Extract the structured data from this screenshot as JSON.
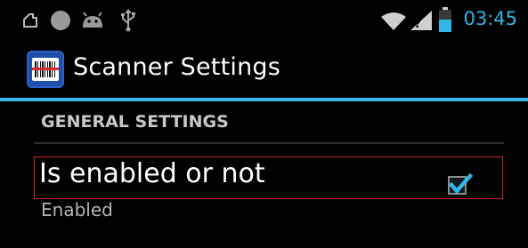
{
  "status_bar": {
    "time": "03:45",
    "time_color": "#33b5e5",
    "icons_left": [
      "notification-icon",
      "circle-icon",
      "android-icon",
      "usb-icon"
    ],
    "icons_right": [
      "wifi-icon",
      "signal-icon",
      "battery-icon"
    ]
  },
  "action_bar": {
    "title": "Scanner Settings",
    "icon": "barcode-scanner-app-icon",
    "accent_color": "#33b5e5"
  },
  "preferences": {
    "category_title": "GENERAL SETTINGS",
    "items": [
      {
        "title": "Is enabled or not",
        "summary": "Enabled",
        "checked": true,
        "highlight_color": "#c8242a"
      }
    ]
  }
}
